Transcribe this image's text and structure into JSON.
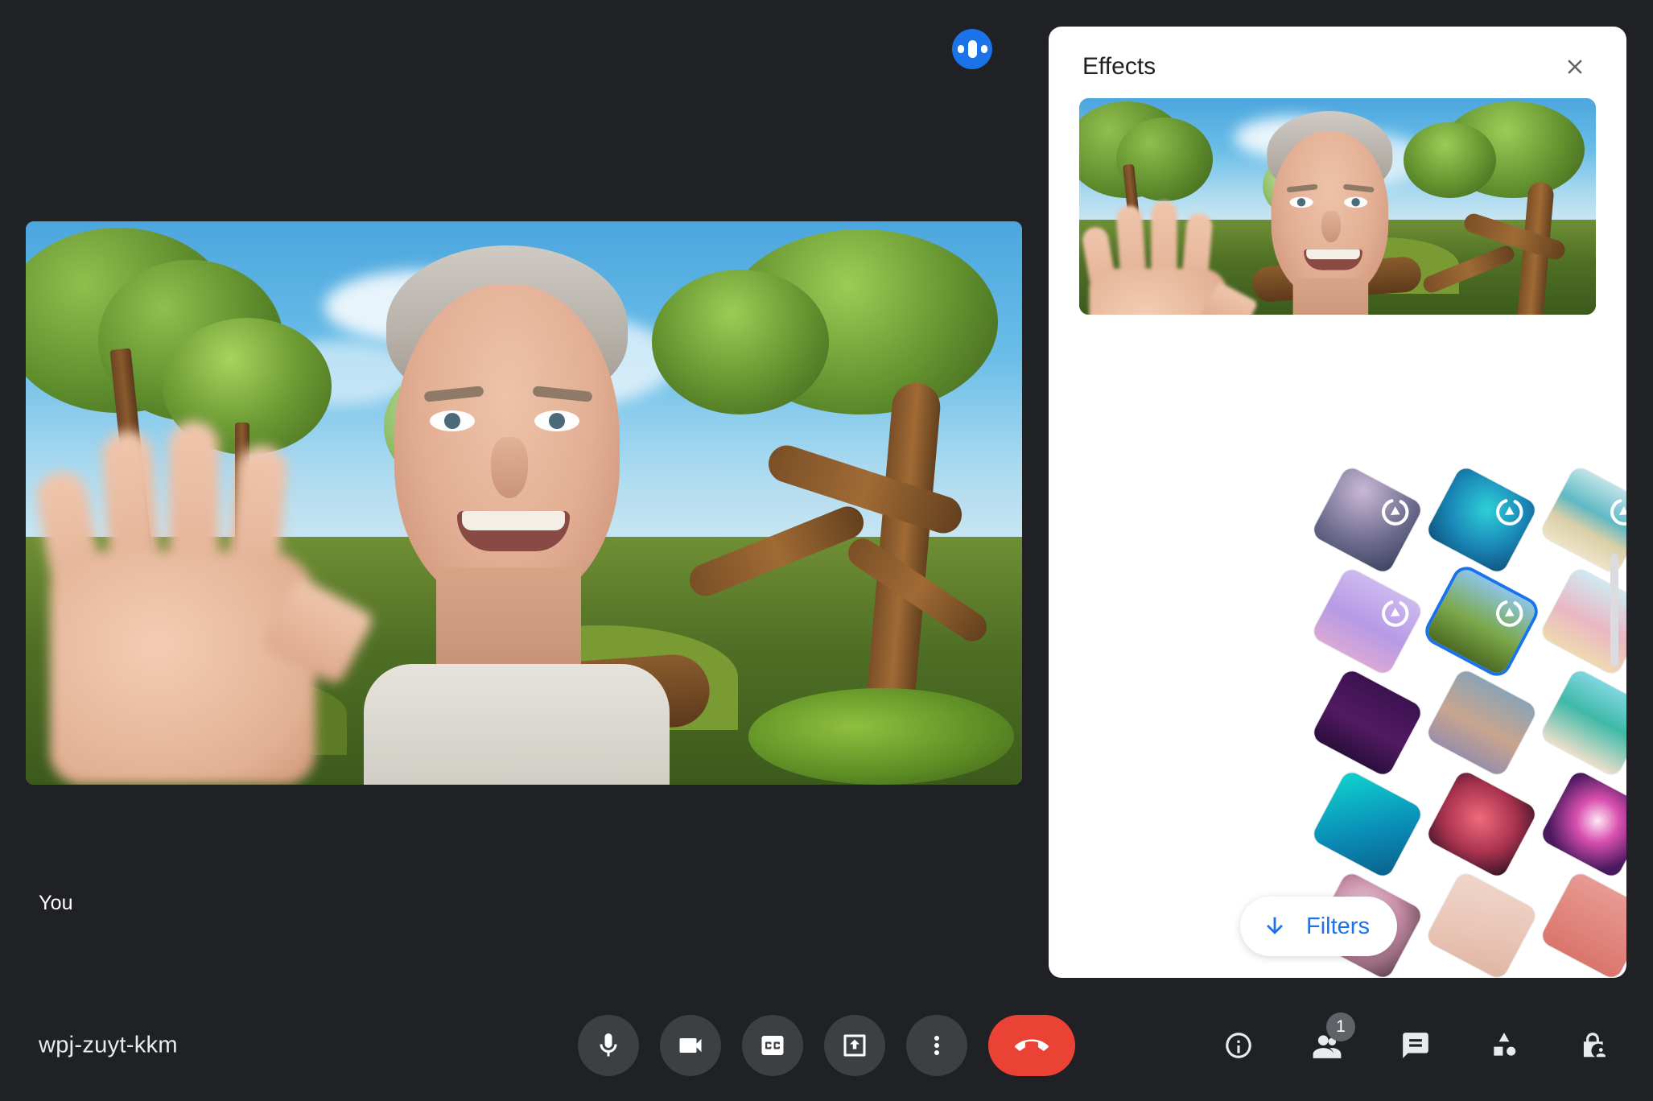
{
  "meeting": {
    "code": "wpj-zuyt-kkm",
    "self_tile_label": "You",
    "speaking_indicator": "audio-level-icon"
  },
  "effects_panel": {
    "title": "Effects",
    "close_label": "Close",
    "preview_alt": "self-view-preview",
    "filters_button": {
      "label": "Filters",
      "icon": "arrow-down-icon",
      "color": "#1a73e8"
    },
    "scrollbar": "effects-scrollbar",
    "selected_index": 5,
    "backgrounds": [
      {
        "name": "spaceship-cockpit",
        "has_play": true,
        "style": "background:radial-gradient(circle at 30% 20%,#c9b8d6 0%,#6b6a8c 60%,#3c3f5e 100%)"
      },
      {
        "name": "underwater-cave",
        "has_play": true,
        "style": "background:radial-gradient(circle at 50% 35%,#2fd0d8 0%,#1a89b8 55%,#0e4f78 100%)"
      },
      {
        "name": "tropical-beach",
        "has_play": true,
        "style": "background:linear-gradient(180deg,#bfe4e8 0%,#5fb9c4 42%,#d9cfa8 68%,#efe3c8 100%)"
      },
      {
        "name": "fruit-kitchen",
        "has_play": true,
        "style": "background:linear-gradient(180deg,#d6e8c9 0%,#a9cf88 50%,#e4e2c0 100%)"
      },
      {
        "name": "pastel-monster-room",
        "has_play": true,
        "style": "background:linear-gradient(180deg,#cdb9ef 0%,#b79ae6 55%,#d9a8d6 100%)"
      },
      {
        "name": "enchanted-forest",
        "has_play": true,
        "style": "background:linear-gradient(180deg,#8dc5e8 0%,#7ca84a 55%,#4c6b24 100%)"
      },
      {
        "name": "pride-illustration",
        "has_play": false,
        "style": "background:linear-gradient(180deg,#cfe9f2 0%,#e9b7c3 55%,#efd9b0 100%)"
      },
      {
        "name": "koi-wave-art",
        "has_play": false,
        "style": "background:linear-gradient(140deg,#f3e6e0 0%,#e4502a 45%,#bdd3cf 100%)"
      },
      {
        "name": "night-festival",
        "has_play": false,
        "style": "background:linear-gradient(180deg,#3b1250 0%,#521a63 55%,#2b0f3c 100%)"
      },
      {
        "name": "dusk-gradient",
        "has_play": false,
        "style": "background:linear-gradient(180deg,#8ba3b5 0%,#c9a58f 55%,#9a8fa8 100%)"
      },
      {
        "name": "calm-beach",
        "has_play": false,
        "style": "background:linear-gradient(180deg,#7fd6e0 0%,#3fb9a8 45%,#ece0cc 100%)"
      },
      {
        "name": "pastel-clouds",
        "has_play": false,
        "style": "background:linear-gradient(150deg,#4f9fe8 0%,#c6b4ea 45%,#edb8d6 100%)"
      },
      {
        "name": "turquoise-water",
        "has_play": false,
        "style": "background:linear-gradient(140deg,#0fd6cf 0%,#0a8fb8 55%,#0b5f8c 100%)"
      },
      {
        "name": "pink-nebula",
        "has_play": false,
        "style": "background:radial-gradient(ellipse at 45% 45%,#f06a7a 0%,#a8324e 55%,#2a1020 100%)"
      },
      {
        "name": "fireworks",
        "has_play": false,
        "style": "background:radial-gradient(circle at 50% 45%,#ffe8f4 0%,#d94fb0 35%,#4a1a5e 80%)"
      },
      {
        "name": "red-blossoms",
        "has_play": false,
        "style": "background:linear-gradient(180deg,#b8c9c3 0%,#d9705f 60%,#e8897a 100%)"
      },
      {
        "name": "rose-garden",
        "has_play": false,
        "style": "background:radial-gradient(circle at 40% 40%,#f3dfe6 0%,#c98fa8 50%,#5a3d4a 100%)"
      },
      {
        "name": "blush-bokeh",
        "has_play": false,
        "style": "background:linear-gradient(160deg,#f0d6cd 0%,#e8c4b4 60%,#dfb5a3 100%)"
      },
      {
        "name": "pink-tile",
        "has_play": false,
        "style": "background:linear-gradient(180deg,#e89a93 0%,#d9756d 100%)"
      },
      {
        "name": "confetti",
        "has_play": false,
        "style": "background:linear-gradient(150deg,#f7e3ec 0%,#f0c9da 55%,#e8aec9 100%)"
      }
    ]
  },
  "toolbar": {
    "center": [
      {
        "name": "microphone-button",
        "icon": "microphone-icon",
        "label": "Turn off microphone"
      },
      {
        "name": "camera-button",
        "icon": "video-camera-icon",
        "label": "Turn off camera"
      },
      {
        "name": "captions-button",
        "icon": "closed-captions-icon",
        "label": "Turn on captions"
      },
      {
        "name": "present-button",
        "icon": "present-screen-icon",
        "label": "Present now"
      },
      {
        "name": "more-options-button",
        "icon": "more-vertical-icon",
        "label": "More options"
      },
      {
        "name": "leave-call-button",
        "icon": "phone-hangup-icon",
        "label": "Leave call"
      }
    ],
    "right": [
      {
        "name": "meeting-details-button",
        "icon": "info-icon",
        "label": "Meeting details",
        "badge": null
      },
      {
        "name": "people-button",
        "icon": "people-icon",
        "label": "People",
        "badge": "1"
      },
      {
        "name": "chat-button",
        "icon": "chat-bubble-icon",
        "label": "Chat with everyone",
        "badge": null
      },
      {
        "name": "activities-button",
        "icon": "activities-shapes-icon",
        "label": "Activities",
        "badge": null
      },
      {
        "name": "host-controls-button",
        "icon": "lock-person-icon",
        "label": "Host controls",
        "badge": null
      }
    ]
  },
  "colors": {
    "app_background": "#202124",
    "panel_background": "#ffffff",
    "accent_blue": "#1a73e8",
    "hangup_red": "#ea4335",
    "control_gray": "#3c4043"
  }
}
